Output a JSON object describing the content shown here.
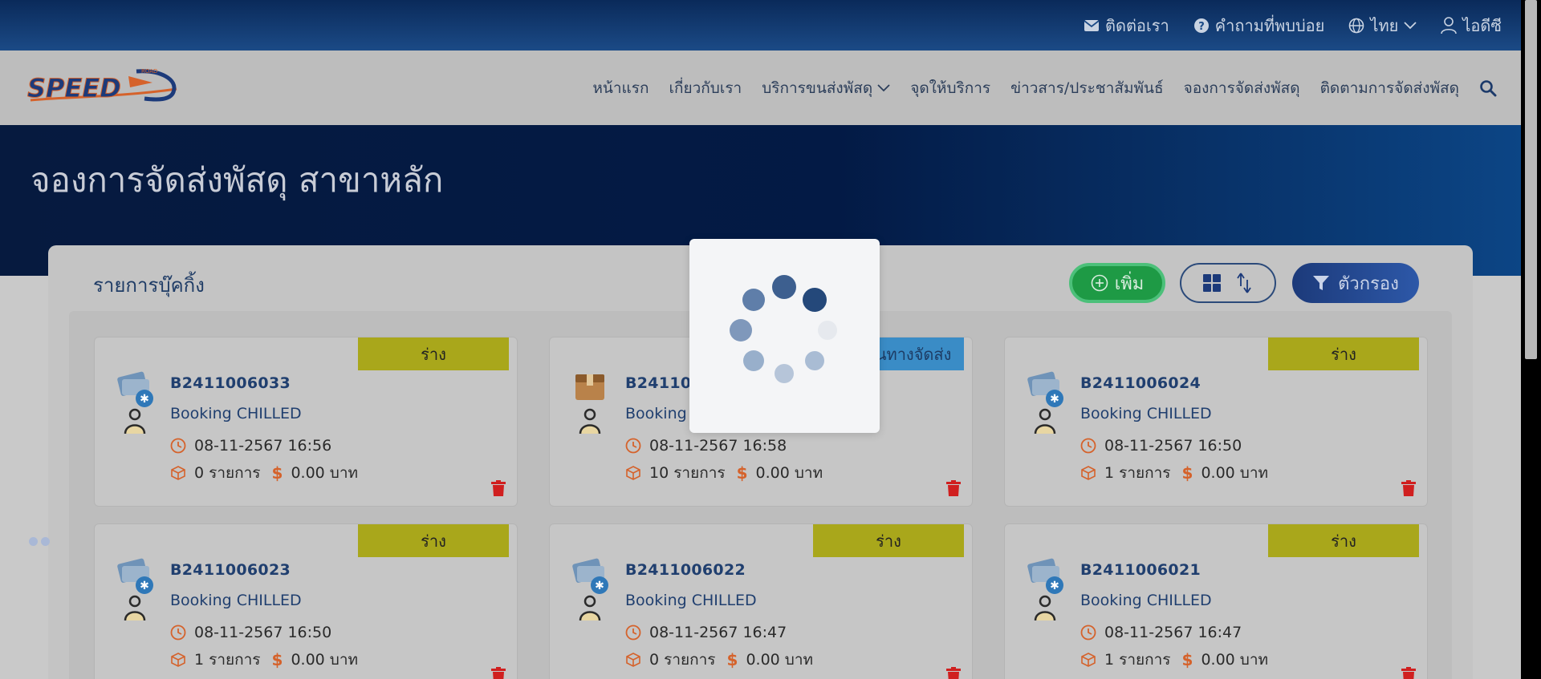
{
  "topbar": {
    "contact": "ติดต่อเรา",
    "faq": "คำถามที่พบบ่อย",
    "language": "ไทย",
    "user": "ไอดีซี"
  },
  "logo": {
    "text": "SPEED",
    "tag": "D"
  },
  "nav": {
    "items": [
      "หน้าแรก",
      "เกี่ยวกับเรา",
      "บริการขนส่งพัสดุ",
      "จุดให้บริการ",
      "ข่าวสาร/ประชาสัมพันธ์",
      "จองการจัดส่งพัสดุ",
      "ติดตามการจัดส่งพัสดุ"
    ]
  },
  "hero": {
    "title": "จองการจัดส่งพัสดุ สาขาหลัก"
  },
  "panel": {
    "title": "รายการบุ๊คกิ้ง",
    "add_label": "เพิ่ม",
    "filter_label": "ตัวกรอง"
  },
  "cards": [
    {
      "badge": "ร่าง",
      "code": "B2411006033",
      "type": "Booking CHILLED",
      "datetime": "08-11-2567 16:56",
      "items": "0 รายการ",
      "amount": "0.00 บาท"
    },
    {
      "badge": "เลือกเส้นทางจัดส่ง",
      "code": "B2411006027",
      "type": "Booking DRY",
      "datetime": "08-11-2567 16:58",
      "items": "10 รายการ",
      "amount": "0.00 บาท"
    },
    {
      "badge": "ร่าง",
      "code": "B2411006024",
      "type": "Booking CHILLED",
      "datetime": "08-11-2567 16:50",
      "items": "1 รายการ",
      "amount": "0.00 บาท"
    },
    {
      "badge": "ร่าง",
      "code": "B2411006023",
      "type": "Booking CHILLED",
      "datetime": "08-11-2567 16:50",
      "items": "1 รายการ",
      "amount": "0.00 บาท"
    },
    {
      "badge": "ร่าง",
      "code": "B2411006022",
      "type": "Booking CHILLED",
      "datetime": "08-11-2567 16:47",
      "items": "0 รายการ",
      "amount": "0.00 บาท"
    },
    {
      "badge": "ร่าง",
      "code": "B2411006021",
      "type": "Booking CHILLED",
      "datetime": "08-11-2567 16:47",
      "items": "1 รายการ",
      "amount": "0.00 บาท"
    }
  ],
  "colors": {
    "accent_blue": "#203f6f",
    "badge_draft": "#a9a71b",
    "badge_route": "#3a8cc6",
    "add_green": "#1e9a45",
    "danger_red": "#d01f1f",
    "icon_orange": "#d5622b"
  }
}
